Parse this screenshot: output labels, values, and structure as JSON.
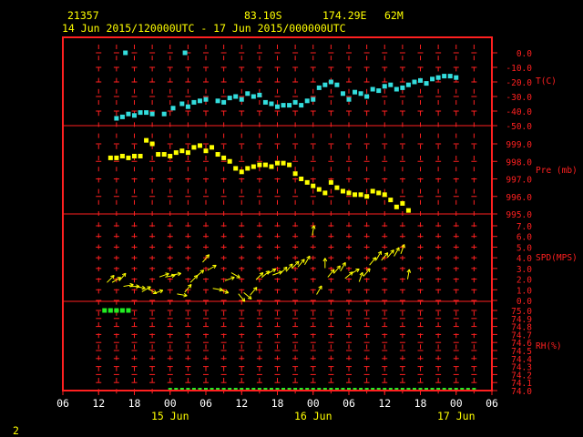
{
  "header": {
    "station_id": "21357",
    "lat": "83.10S",
    "lon": "174.29E",
    "elev": "62M",
    "range": "14 Jun 2015/120000UTC - 17 Jun 2015/000000UTC"
  },
  "footer": {
    "page": "2"
  },
  "colors": {
    "frame": "#ff2020",
    "label": "#ffff00",
    "temp": "#33dddd",
    "pres": "#ffff00",
    "wind": "#ffff00",
    "rh": "#22ee22",
    "white": "#ffffff"
  },
  "chart_data": {
    "type": "scatter",
    "x_unit": "hours since 14 Jun 2015 06 UTC",
    "x_range": [
      0,
      72
    ],
    "x_tick_labels": [
      "06",
      "12",
      "18",
      "00",
      "06",
      "12",
      "18",
      "00",
      "06",
      "12",
      "18",
      "00",
      "06"
    ],
    "date_labels": [
      {
        "text": "15 Jun",
        "hour": 18
      },
      {
        "text": "16 Jun",
        "hour": 42
      },
      {
        "text": "17 Jun",
        "hour": 66
      }
    ],
    "panels": [
      {
        "id": "temp",
        "label": "T(C)",
        "ticks": [
          "0.0",
          "-10.0",
          "-20.0",
          "-30.0",
          "-40.0",
          "-50.0"
        ],
        "ylim": [
          -50,
          0
        ],
        "points": [
          [
            9,
            -45
          ],
          [
            10,
            -44
          ],
          [
            11,
            -42
          ],
          [
            12,
            -43
          ],
          [
            13,
            -41
          ],
          [
            14,
            -41
          ],
          [
            15,
            -42
          ],
          [
            17,
            -42
          ],
          [
            18.5,
            -38
          ],
          [
            20,
            -35
          ],
          [
            21,
            -37
          ],
          [
            22,
            -34
          ],
          [
            23,
            -33
          ],
          [
            24,
            -32
          ],
          [
            26,
            -33
          ],
          [
            27,
            -34
          ],
          [
            28,
            -31
          ],
          [
            29,
            -30
          ],
          [
            30,
            -32
          ],
          [
            31,
            -28
          ],
          [
            32,
            -30
          ],
          [
            33,
            -29
          ],
          [
            34,
            -34
          ],
          [
            35,
            -35
          ],
          [
            36,
            -37
          ],
          [
            37,
            -36
          ],
          [
            38,
            -36
          ],
          [
            39,
            -34
          ],
          [
            40,
            -36
          ],
          [
            41,
            -33
          ],
          [
            42,
            -32
          ],
          [
            43,
            -24
          ],
          [
            44,
            -22
          ],
          [
            45,
            -20
          ],
          [
            46,
            -22
          ],
          [
            47,
            -28
          ],
          [
            48,
            -32
          ],
          [
            49,
            -27
          ],
          [
            50,
            -28
          ],
          [
            51,
            -30
          ],
          [
            52,
            -25
          ],
          [
            53,
            -26
          ],
          [
            54,
            -23
          ],
          [
            55,
            -22
          ],
          [
            56,
            -25
          ],
          [
            57,
            -24
          ],
          [
            58,
            -22
          ],
          [
            59,
            -20
          ],
          [
            60,
            -19
          ],
          [
            61,
            -21
          ],
          [
            62,
            -18
          ],
          [
            63,
            -17
          ],
          [
            64,
            -16
          ],
          [
            65,
            -16
          ],
          [
            66,
            -17
          ],
          [
            10.5,
            0
          ],
          [
            20.5,
            0
          ]
        ]
      },
      {
        "id": "pres",
        "label": "Pre (mb)",
        "ticks": [
          "999.0",
          "998.0",
          "997.0",
          "996.0",
          "995.0"
        ],
        "ylim": [
          995,
          999
        ],
        "points": [
          [
            8,
            998.2
          ],
          [
            9,
            998.2
          ],
          [
            10,
            998.3
          ],
          [
            11,
            998.2
          ],
          [
            12,
            998.3
          ],
          [
            13,
            998.3
          ],
          [
            14,
            999.2
          ],
          [
            15,
            999.0
          ],
          [
            16,
            998.4
          ],
          [
            17,
            998.4
          ],
          [
            18,
            998.3
          ],
          [
            19,
            998.5
          ],
          [
            20,
            998.6
          ],
          [
            21,
            998.5
          ],
          [
            22,
            998.8
          ],
          [
            23,
            998.9
          ],
          [
            24,
            998.6
          ],
          [
            25,
            998.8
          ],
          [
            26,
            998.4
          ],
          [
            27,
            998.2
          ],
          [
            28,
            998.0
          ],
          [
            29,
            997.6
          ],
          [
            30,
            997.4
          ],
          [
            31,
            997.6
          ],
          [
            32,
            997.7
          ],
          [
            33,
            997.8
          ],
          [
            34,
            997.8
          ],
          [
            35,
            997.7
          ],
          [
            36,
            997.9
          ],
          [
            37,
            997.9
          ],
          [
            38,
            997.8
          ],
          [
            39,
            997.3
          ],
          [
            40,
            997.0
          ],
          [
            41,
            996.8
          ],
          [
            42,
            996.6
          ],
          [
            43,
            996.4
          ],
          [
            44,
            996.2
          ],
          [
            45,
            996.8
          ],
          [
            46,
            996.5
          ],
          [
            47,
            996.3
          ],
          [
            48,
            996.2
          ],
          [
            49,
            996.1
          ],
          [
            50,
            996.1
          ],
          [
            51,
            996.0
          ],
          [
            52,
            996.3
          ],
          [
            53,
            996.2
          ],
          [
            54,
            996.1
          ],
          [
            55,
            995.8
          ],
          [
            56,
            995.4
          ],
          [
            57,
            995.6
          ],
          [
            58,
            995.2
          ]
        ]
      },
      {
        "id": "wind",
        "label": "SPD(MPS)",
        "ticks": [
          "7.0",
          "6.0",
          "5.0",
          "4.0",
          "3.0",
          "2.0",
          "1.0",
          "0.0"
        ],
        "ylim": [
          0,
          8
        ],
        "points": [
          [
            8,
            2.3,
            45
          ],
          [
            9,
            2.2,
            60
          ],
          [
            10,
            2.5,
            40
          ],
          [
            11,
            1.6,
            80
          ],
          [
            12,
            1.5,
            90
          ],
          [
            13,
            1.4,
            100
          ],
          [
            14,
            1.2,
            60
          ],
          [
            15,
            1.0,
            120
          ],
          [
            16,
            0.9,
            70
          ],
          [
            17,
            2.7,
            70
          ],
          [
            18,
            2.6,
            80
          ],
          [
            19,
            2.8,
            80
          ],
          [
            20,
            0.6,
            100
          ],
          [
            21,
            1.3,
            40
          ],
          [
            22,
            2.3,
            45
          ],
          [
            23,
            2.9,
            50
          ],
          [
            24,
            4.5,
            40
          ],
          [
            25,
            3.5,
            60
          ],
          [
            26,
            1.2,
            100
          ],
          [
            27,
            1.0,
            110
          ],
          [
            28,
            2.3,
            70
          ],
          [
            29,
            2.7,
            120
          ],
          [
            30,
            0.3,
            140
          ],
          [
            31,
            0.5,
            130
          ],
          [
            32,
            1.0,
            40
          ],
          [
            33,
            2.6,
            45
          ],
          [
            34,
            2.8,
            50
          ],
          [
            35,
            3.1,
            60
          ],
          [
            36,
            2.9,
            70
          ],
          [
            37,
            3.2,
            45
          ],
          [
            38,
            3.5,
            40
          ],
          [
            39,
            3.8,
            45
          ],
          [
            40,
            4.0,
            40
          ],
          [
            41,
            4.3,
            30
          ],
          [
            42,
            7.5,
            10
          ],
          [
            43,
            1.1,
            30
          ],
          [
            44,
            4.0,
            0
          ],
          [
            45,
            2.9,
            40
          ],
          [
            46,
            3.3,
            40
          ],
          [
            47,
            3.6,
            30
          ],
          [
            48,
            2.7,
            50
          ],
          [
            49,
            3.1,
            60
          ],
          [
            50,
            2.5,
            20
          ],
          [
            51,
            3.0,
            40
          ],
          [
            52,
            4.2,
            40
          ],
          [
            53,
            4.8,
            30
          ],
          [
            54,
            4.7,
            40
          ],
          [
            55,
            5.0,
            40
          ],
          [
            56,
            5.2,
            30
          ],
          [
            57,
            5.5,
            20
          ],
          [
            58,
            2.8,
            10
          ]
        ]
      },
      {
        "id": "rh",
        "label": "RH(%)",
        "ticks": [
          "75.0",
          "74.9",
          "74.8",
          "74.7",
          "74.6",
          "74.5",
          "74.4",
          "74.3",
          "74.2",
          "74.1",
          "74.0"
        ],
        "ylim": [
          74.0,
          75.0
        ],
        "points": [
          [
            7,
            75.0
          ],
          [
            8,
            75.0
          ],
          [
            9,
            75.0
          ],
          [
            10,
            75.0
          ],
          [
            11,
            75.0
          ]
        ]
      }
    ]
  }
}
